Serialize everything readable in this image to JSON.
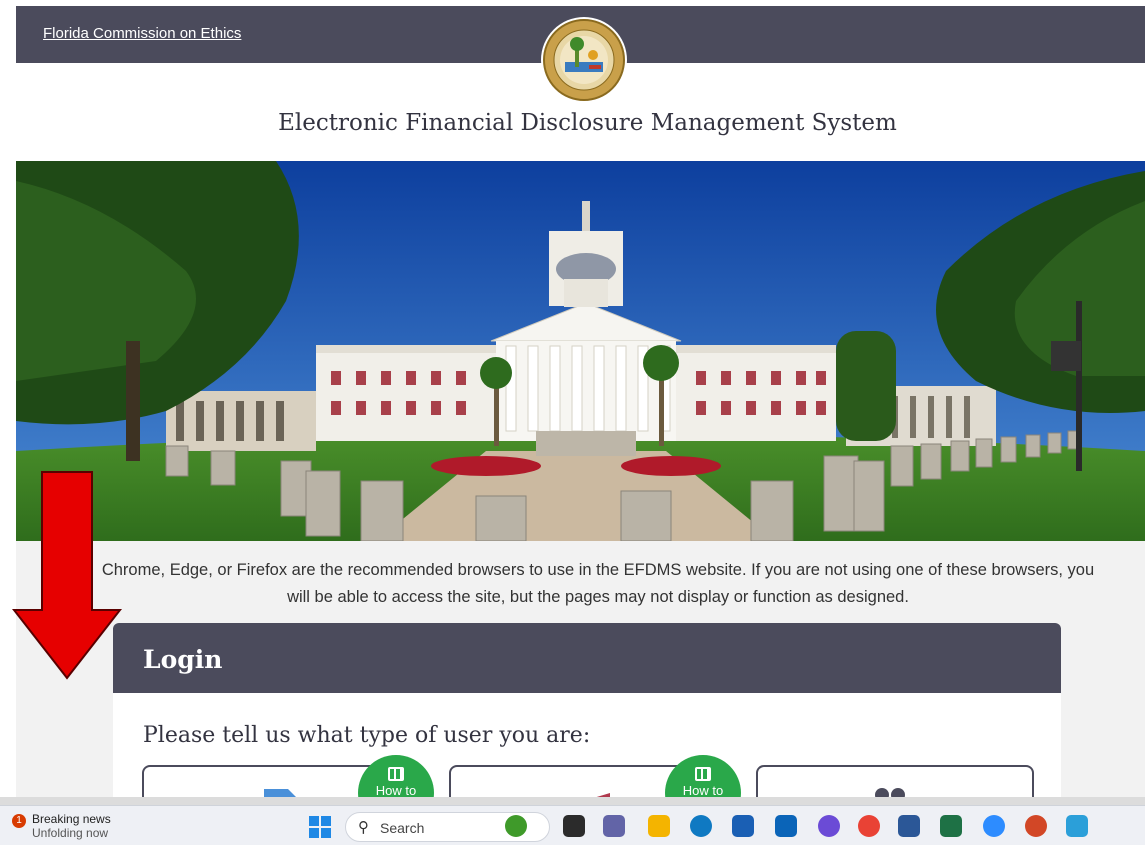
{
  "header": {
    "org_link": "Florida Commission on Ethics",
    "system_title": "Electronic Financial Disclosure Management System"
  },
  "notice": {
    "text": "Chrome, Edge, or Firefox are the recommended browsers to use in the EFDMS website. If you are not using one of these browsers, you will be able to access the site, but the pages may not display or function as designed."
  },
  "login": {
    "title": "Login",
    "prompt": "Please tell us what type of user you are:",
    "how_to_label": "How to"
  },
  "taskbar": {
    "news_badge": "1",
    "news_title": "Breaking news",
    "news_subtitle": "Unfolding now",
    "search_placeholder": "Search"
  },
  "colors": {
    "header_bg": "#4b4b5c",
    "howto_green": "#2aa84a",
    "arrow_red": "#e60000"
  }
}
